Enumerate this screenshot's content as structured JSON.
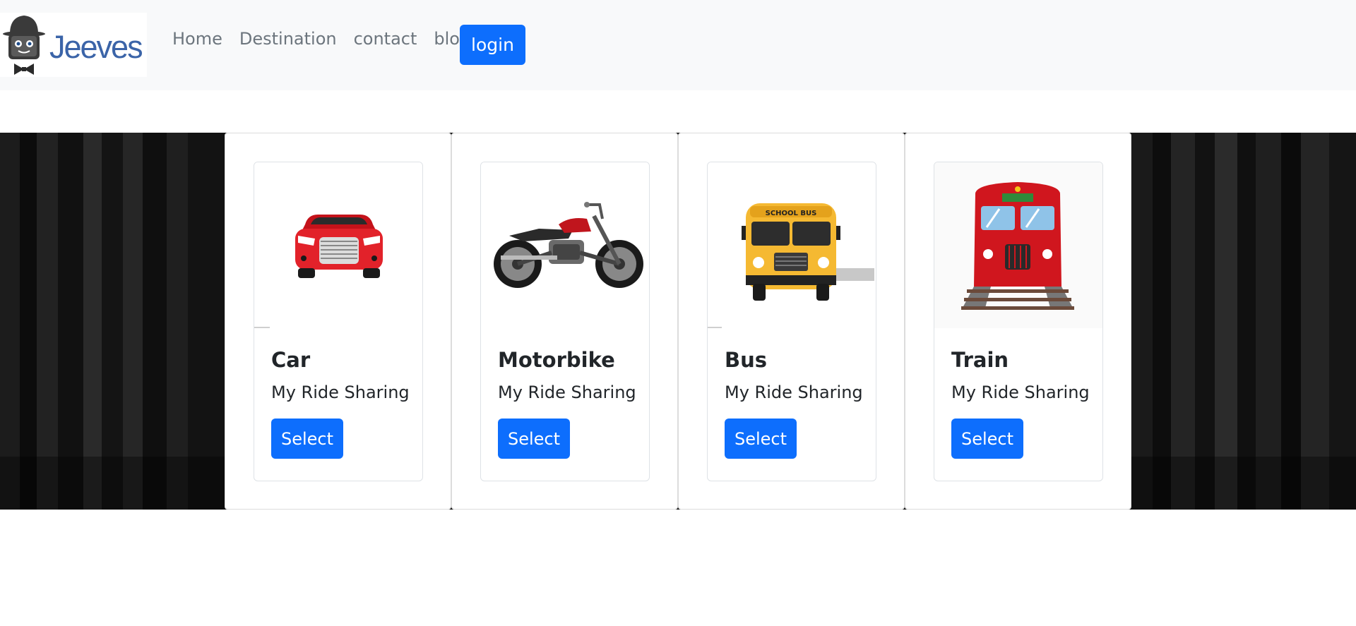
{
  "brand": {
    "name": "Jeeves"
  },
  "nav": {
    "links": [
      {
        "label": "Home"
      },
      {
        "label": "Destination"
      },
      {
        "label": "contact"
      },
      {
        "label": "blog"
      }
    ],
    "login_label": "login"
  },
  "cards": [
    {
      "title": "Car",
      "text": "My Ride Sharing",
      "button": "Select",
      "icon": "car-image"
    },
    {
      "title": "Motorbike",
      "text": "My Ride Sharing",
      "button": "Select",
      "icon": "motorbike-image"
    },
    {
      "title": "Bus",
      "text": "My Ride Sharing",
      "button": "Select",
      "icon": "school-bus-image",
      "bus_sign": "SCHOOL BUS"
    },
    {
      "title": "Train",
      "text": "My Ride Sharing",
      "button": "Select",
      "icon": "train-image"
    }
  ],
  "colors": {
    "primary": "#0d6efd",
    "navbar_bg": "#f8f9fa",
    "brand_text": "#3b64a8"
  }
}
